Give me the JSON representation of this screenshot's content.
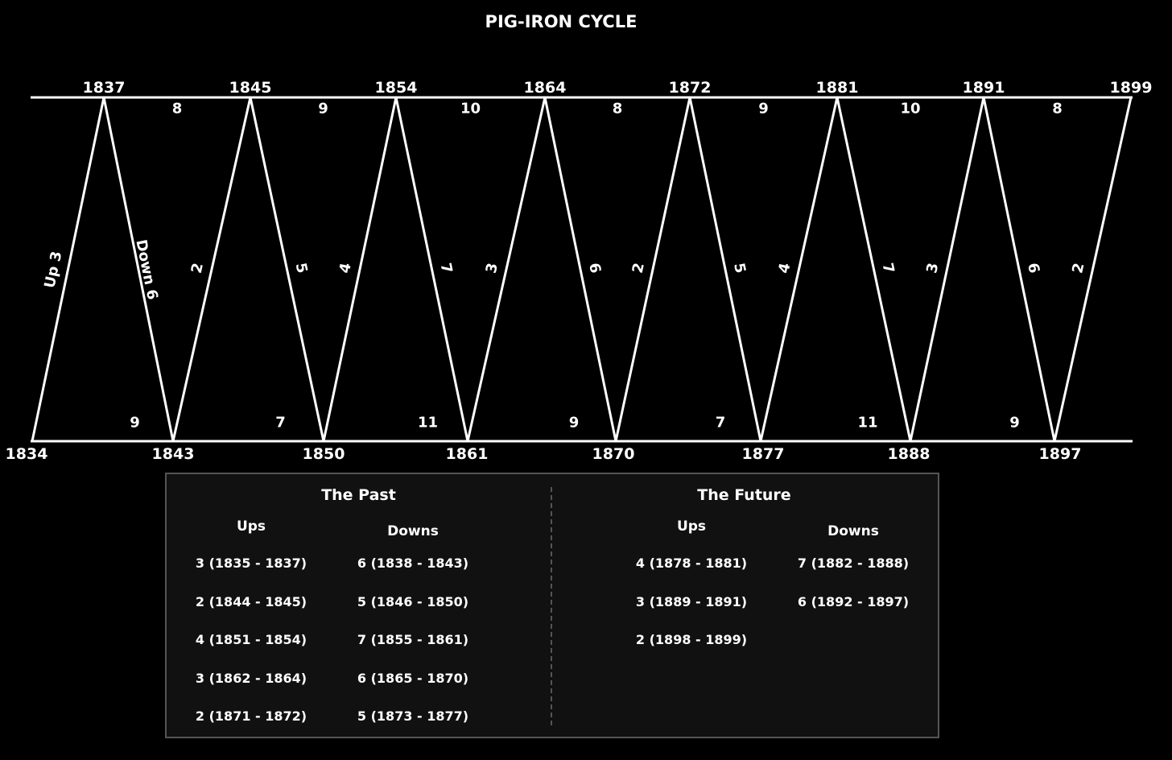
{
  "title": "PIG-IRON CYCLE",
  "peaks": [
    "1837",
    "1845",
    "1854",
    "1864",
    "1872",
    "1881",
    "1891",
    "1899"
  ],
  "troughs": [
    "1834",
    "1843",
    "1850",
    "1861",
    "1870",
    "1877",
    "1888",
    "1897"
  ],
  "top_spans": [
    "8",
    "9",
    "10",
    "8",
    "9",
    "10",
    "8"
  ],
  "bottom_spans": [
    "9",
    "7",
    "11",
    "9",
    "7",
    "11",
    "9"
  ],
  "segment_labels": [
    "Up 3",
    "Down 6",
    "2",
    "5",
    "4",
    "7",
    "3",
    "6",
    "2",
    "5",
    "4",
    "7",
    "3",
    "6",
    "2"
  ],
  "past": {
    "title": "The Past",
    "ups_header": "Ups",
    "downs_header": "Downs",
    "ups": [
      "3 (1835 - 1837)",
      "2 (1844 - 1845)",
      "4 (1851 - 1854)",
      "3 (1862 - 1864)",
      "2 (1871 - 1872)"
    ],
    "downs": [
      "6 (1838 - 1843)",
      "5 (1846 - 1850)",
      "7 (1855 - 1861)",
      "6 (1865 - 1870)",
      "5 (1873 - 1877)"
    ]
  },
  "future": {
    "title": "The Future",
    "ups_header": "Ups",
    "downs_header": "Downs",
    "ups": [
      "4 (1878 - 1881)",
      "3 (1889 - 1891)",
      "2 (1898 - 1899)"
    ],
    "downs": [
      "7 (1882 - 1888)",
      "6 (1892 - 1897)"
    ]
  },
  "colors": {
    "background": "#000000",
    "line": "#ffffff",
    "panel": "#111111",
    "panel_border": "#555555"
  }
}
